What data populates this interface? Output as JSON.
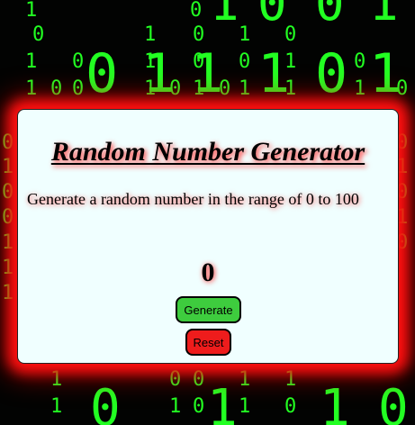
{
  "app": {
    "title": "Random Number Generator",
    "description": "Generate a random number in the range of 0 to 100",
    "current_number": "0"
  },
  "buttons": {
    "generate_label": "Generate",
    "reset_label": "Reset"
  },
  "background": {
    "style": "binary digital rain",
    "digits": [
      "1",
      "0",
      "1",
      "0",
      "1",
      "0",
      "0",
      "1",
      "0",
      "1",
      "0",
      "0",
      "1",
      "0",
      "1",
      "0",
      "0",
      "1",
      "0",
      "1",
      "0",
      "1",
      "1",
      "1",
      "0",
      "0",
      "1",
      "0",
      "0",
      "1",
      "1",
      "1",
      "0",
      "1",
      "0",
      "1",
      "0",
      "1",
      "0",
      "0",
      "1",
      "1",
      "1",
      "1",
      "0",
      "1",
      "0",
      "1",
      "0",
      "0",
      "1",
      "0",
      "1",
      "1",
      "1",
      "0",
      "1",
      "0",
      "1",
      "1",
      "0",
      "1",
      "0",
      "1",
      "0",
      "1",
      "0",
      "1",
      "0"
    ]
  },
  "colors": {
    "accent_glow": "#ff1010",
    "card_background": "#f0ffff",
    "generate_button": "#3ecc3e",
    "reset_button": "#ee1c1c",
    "digit_color": "#22ff22"
  }
}
